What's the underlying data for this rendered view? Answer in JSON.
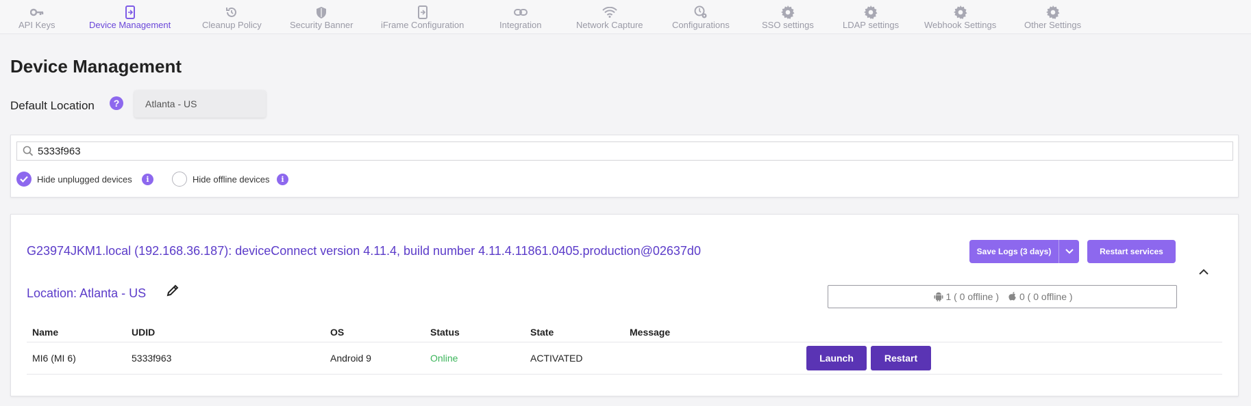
{
  "nav": {
    "items": [
      {
        "label": "API Keys",
        "icon": "key-icon"
      },
      {
        "label": "Device Management",
        "icon": "device-icon",
        "active": true
      },
      {
        "label": "Cleanup Policy",
        "icon": "history-icon"
      },
      {
        "label": "Security Banner",
        "icon": "shield-icon"
      },
      {
        "label": "iFrame Configuration",
        "icon": "device-icon"
      },
      {
        "label": "Integration",
        "icon": "link-icon"
      },
      {
        "label": "Network Capture",
        "icon": "wifi-icon"
      },
      {
        "label": "Configurations",
        "icon": "clock-gear-icon"
      },
      {
        "label": "SSO settings",
        "icon": "gear-icon"
      },
      {
        "label": "LDAP settings",
        "icon": "gear-icon"
      },
      {
        "label": "Webhook Settings",
        "icon": "gear-icon"
      },
      {
        "label": "Other Settings",
        "icon": "gear-icon"
      }
    ]
  },
  "page": {
    "title": "Device Management",
    "default_location_label": "Default Location",
    "help_glyph": "?",
    "default_location_value": "Atlanta - US"
  },
  "filters": {
    "search_value": "5333f963",
    "hide_unplugged": {
      "label": "Hide unplugged devices",
      "checked": true
    },
    "hide_offline": {
      "label": "Hide offline devices",
      "checked": false
    },
    "info_glyph": "i"
  },
  "host": {
    "title": "G23974JKM1.local (192.168.36.187): deviceConnect version 4.11.4, build number 4.11.4.11861.0405.production@02637d0",
    "save_logs_label": "Save Logs (3 days)",
    "restart_services_label": "Restart services",
    "location_label": "Location: Atlanta - US",
    "android_count": "1 ( 0 offline )",
    "ios_count": "0 ( 0 offline )",
    "columns": [
      "Name",
      "UDID",
      "OS",
      "Status",
      "State",
      "Message"
    ],
    "rows": [
      {
        "name": "MI6 (MI 6)",
        "udid": "5333f963",
        "os": "Android 9",
        "status": "Online",
        "state": "ACTIVATED",
        "message": ""
      }
    ],
    "launch_label": "Launch",
    "restart_label": "Restart"
  },
  "colors": {
    "accent": "#8d68ee",
    "accent_dark": "#5a34b4",
    "online": "#3bb55a",
    "link": "#5b3bc9"
  }
}
